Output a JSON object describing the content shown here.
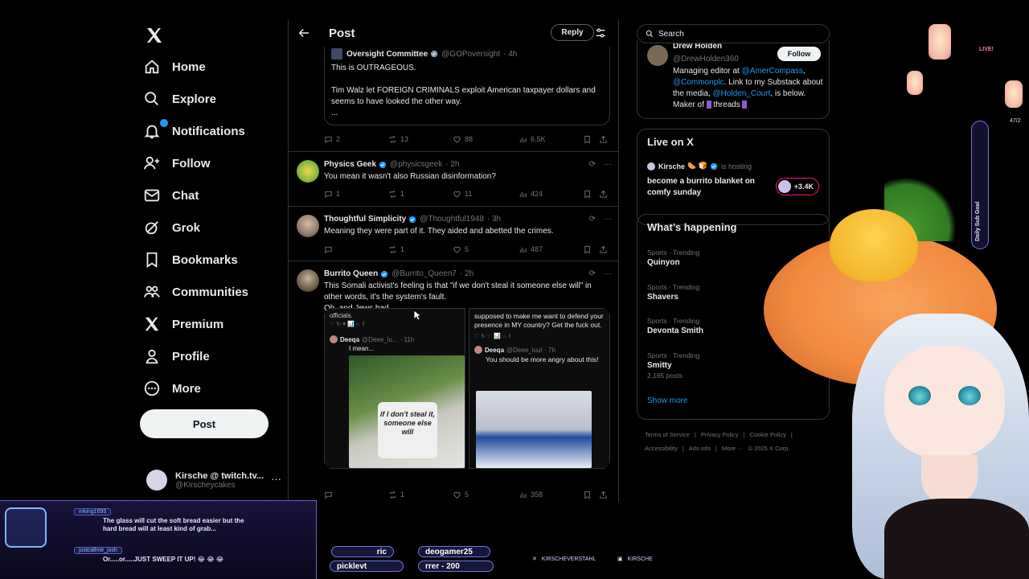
{
  "app": {
    "title": "X"
  },
  "nav": {
    "items": [
      {
        "label": "Home"
      },
      {
        "label": "Explore"
      },
      {
        "label": "Notifications",
        "badge": "1"
      },
      {
        "label": "Follow"
      },
      {
        "label": "Chat"
      },
      {
        "label": "Grok"
      },
      {
        "label": "Bookmarks"
      },
      {
        "label": "Communities"
      },
      {
        "label": "Premium"
      },
      {
        "label": "Profile"
      },
      {
        "label": "More"
      }
    ],
    "post_label": "Post",
    "account": {
      "name": "Kirsche @ twitch.tv...",
      "handle": "@Kirscheycakes"
    }
  },
  "header": {
    "title": "Post",
    "reply_label": "Reply"
  },
  "quoted": {
    "name": "Oversight Committee",
    "handle": "@GOPoversight",
    "time": "· 4h",
    "text": "This is OUTRAGEOUS.\n\nTim Walz let FOREIGN CRIMINALS exploit American taxpayer dollars and seems to have looked the other way.\n...",
    "stats": {
      "replies": "2",
      "reposts": "13",
      "likes": "88",
      "views": "6.5K"
    }
  },
  "replies": [
    {
      "name": "Physics Geek",
      "handle": "@physicsgeek",
      "time": "· 2h",
      "text": "You mean it wasn't also Russian disinformation?",
      "stats": {
        "replies": "1",
        "reposts": "1",
        "likes": "11",
        "views": "424"
      }
    },
    {
      "name": "Thoughtful Simplicity",
      "handle": "@Thoughtful1948",
      "time": "· 3h",
      "text": "Meaning they were part of it. They aided and abetted the crimes.",
      "stats": {
        "replies": "",
        "reposts": "1",
        "likes": "5",
        "views": "487"
      }
    },
    {
      "name": "Burrito Queen",
      "handle": "@Burrito_Queen7",
      "time": "· 2h",
      "text": "This Somali activist's feeling is that \"if we don't steal it someone else will\" in other words, it's the system's fault.\nOh, and Jews bad.",
      "stats": {
        "replies": "",
        "reposts": "1",
        "likes": "5",
        "views": "358"
      }
    }
  ],
  "media": {
    "left": {
      "top_text": "officials.",
      "name": "Deeqa",
      "handle": "@Deee_lu...",
      "time": "· 11h",
      "text": "I mean...",
      "shirt_text": "if I don't steal it, someone else will"
    },
    "right": {
      "top_text": "supposed to make me want to defend your presence in MY country? Get the fuck out.",
      "name": "Deeqa",
      "handle": "@Deee_luul",
      "time": "· 7h",
      "text": "You should be more angry about this!"
    }
  },
  "right": {
    "search_placeholder": "Search",
    "profile": {
      "name": "Drew Holden",
      "handle": "@DrewHolden360",
      "follow_label": "Follow",
      "bio_1": "Managing editor at ",
      "bio_link1": "@AmerCompass",
      "bio_2": ", ",
      "bio_link2": "@Commonplc",
      "bio_3": ". Link to my Substack about the media, ",
      "bio_link3": "@Holden_Court",
      "bio_4": ", is below. Maker of ",
      "bio_5": " threads"
    },
    "live": {
      "title": "Live on X",
      "host": "Kirsche",
      "hosting": "is hosting",
      "stream_title": "become a burrito blanket on comfy sunday",
      "count": "+3.4K"
    },
    "happening": {
      "title": "What’s happening",
      "trends": [
        {
          "meta": "Sports · Trending",
          "name": "Quinyon",
          "posts": ""
        },
        {
          "meta": "Sports · Trending",
          "name": "Shavers",
          "posts": ""
        },
        {
          "meta": "Sports · Trending",
          "name": "Devonta Smith",
          "posts": ""
        },
        {
          "meta": "Sports · Trending",
          "name": "Smitty",
          "posts": "2,165 posts"
        }
      ],
      "show_more": "Show more"
    },
    "footer": [
      "Terms of Service",
      "|",
      "Privacy Policy",
      "|",
      "Cookie Policy",
      "|",
      "Accessibility",
      "|",
      "Ads info",
      "|",
      "More ···",
      "© 2025 X Corp."
    ]
  },
  "overlay": {
    "chat": [
      {
        "user": "mking1695",
        "text": "The glass will cut the soft bread easier but the hard bread will at least kind of grab..."
      },
      {
        "user": "justcallme_josh",
        "text": "Or.....or.....JUST SWEEP IT UP! 😂 😂 😂"
      }
    ],
    "ticker": [
      "ric",
      "deogamer25",
      "picklevt",
      "rrer - 200"
    ],
    "socials": [
      "KIRSCHEVERSTAHL",
      "KIRSCHE"
    ],
    "live_badge": "LIVE!",
    "goal_label": "Daily Sub Goal",
    "goal_count": "47/2"
  },
  "colors": {
    "accent": "#1d9bf0",
    "like": "#f91880",
    "bg": "#000000",
    "border": "#2f3336"
  }
}
